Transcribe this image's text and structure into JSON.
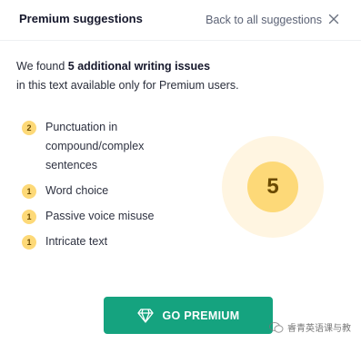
{
  "header": {
    "title": "Premium suggestions",
    "back_link": "Back to all suggestions",
    "close_icon": "close-icon"
  },
  "intro": {
    "prefix": "We found ",
    "highlight": "5 additional writing issues",
    "suffix": "in this text available only for Premium users."
  },
  "issues": [
    {
      "count": "2",
      "label": "Punctuation in compound/complex sentences"
    },
    {
      "count": "1",
      "label": "Word choice"
    },
    {
      "count": "1",
      "label": "Passive voice misuse"
    },
    {
      "count": "1",
      "label": "Intricate text"
    }
  ],
  "total": {
    "count": "5"
  },
  "cta": {
    "label": "GO PREMIUM",
    "icon": "diamond-icon"
  },
  "watermark": {
    "text": "睿青英语课与教"
  },
  "colors": {
    "accent_green": "#15a37f",
    "badge_yellow": "#fdd978",
    "circle_bg": "#fff5e1",
    "text_dark": "#15172b"
  }
}
